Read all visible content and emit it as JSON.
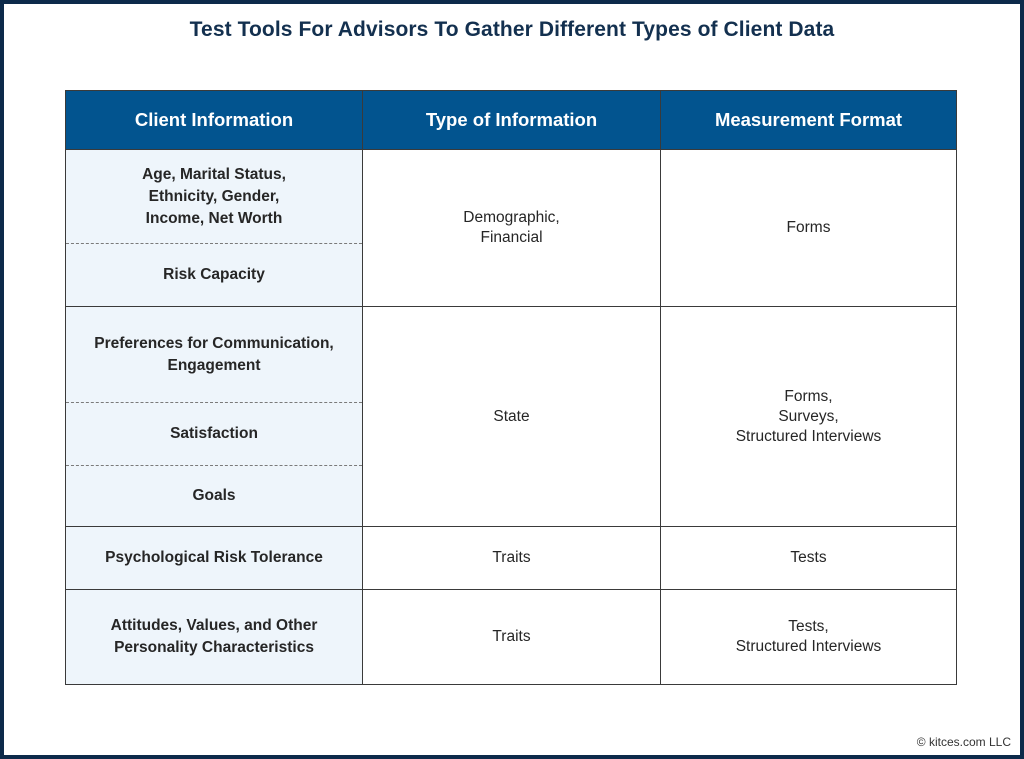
{
  "title": "Test Tools For Advisors To Gather Different Types of Client Data",
  "table": {
    "headers": [
      "Client Information",
      "Type of Information",
      "Measurement Format"
    ],
    "colors": {
      "header_bg": "#02548f",
      "left_col_bg": "#eef5fb",
      "frame": "#0d2a4a"
    },
    "rows": [
      {
        "client_info": [
          "Age, Marital Status, Ethnicity, Gender, Income, Net Worth",
          "Risk Capacity"
        ],
        "type": "Demographic,\nFinancial",
        "format": "Forms"
      },
      {
        "client_info": [
          "Preferences for Communication, Engagement",
          "Satisfaction",
          "Goals"
        ],
        "type": "State",
        "format": "Forms,\nSurveys,\nStructured Interviews"
      },
      {
        "client_info": [
          "Psychological Risk Tolerance"
        ],
        "type": "Traits",
        "format": "Tests"
      },
      {
        "client_info": [
          "Attitudes, Values, and Other Personality Characteristics"
        ],
        "type": "Traits",
        "format": "Tests,\nStructured Interviews"
      }
    ]
  },
  "footer": {
    "copyright": "© kitces.com LLC"
  }
}
